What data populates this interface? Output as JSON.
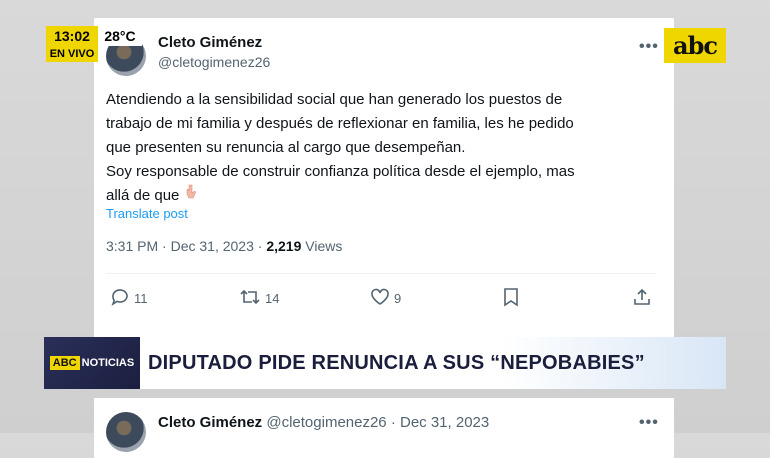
{
  "overlay": {
    "time": "13:02",
    "temperature": "28°C",
    "live_label": "EN VIVO",
    "logo_text": "abc"
  },
  "post": {
    "author_name": "Cleto Giménez",
    "author_handle": "@cletogimenez26",
    "text": "Atendiendo a la sensibilidad social que han generado los puestos de\ntrabajo de mi familia y después de reflexionar en familia, les he pedido\nque presenten su renuncia al cargo que desempeñan.\nSoy responsable de construir confianza política desde el ejemplo,  mas\nallá de que",
    "emoji_icon": "pointing-down-hand-icon",
    "translate_label": "Translate post",
    "time": "3:31 PM",
    "date": "Dec 31, 2023",
    "views_count": "2,219",
    "views_label": "Views",
    "replies": "11",
    "reposts": "14",
    "likes": "9"
  },
  "news_banner": {
    "badge_brand": "ABC",
    "badge_label": "NOTICIAS",
    "headline": "DIPUTADO PIDE RENUNCIA A SUS “NEPOBABIES”"
  },
  "next_post": {
    "author_name": "Cleto Giménez",
    "author_handle": "@cletogimenez26",
    "separator": "·",
    "date": "Dec 31, 2023"
  },
  "colors": {
    "link": "#1d9bf0",
    "secondary_text": "#536471",
    "brand_yellow": "#f0d600",
    "banner_navy": "#1b1f3f"
  }
}
